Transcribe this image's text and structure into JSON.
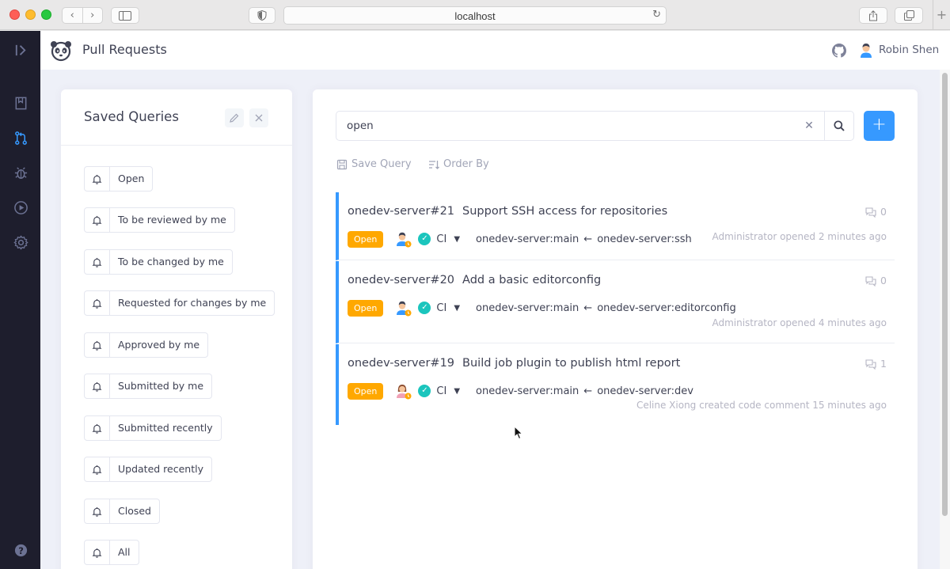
{
  "browser": {
    "url": "localhost"
  },
  "header": {
    "title": "Pull Requests",
    "user_name": "Robin Shen"
  },
  "saved_queries": {
    "title": "Saved Queries",
    "items": [
      {
        "label": "Open"
      },
      {
        "label": "To be reviewed by me"
      },
      {
        "label": "To be changed by me"
      },
      {
        "label": "Requested for changes by me"
      },
      {
        "label": "Approved by me"
      },
      {
        "label": "Submitted by me"
      },
      {
        "label": "Submitted recently"
      },
      {
        "label": "Updated recently"
      },
      {
        "label": "Closed"
      },
      {
        "label": "All"
      }
    ]
  },
  "search": {
    "value": "open"
  },
  "actions": {
    "save_query": "Save Query",
    "order_by": "Order By"
  },
  "pull_requests": [
    {
      "number": "onedev-server#21",
      "title": "Support SSH access for repositories",
      "comments": "0",
      "status": "Open",
      "ci": "CI",
      "target": "onedev-server:main",
      "source": "onedev-server:ssh",
      "activity": "Administrator opened 2 minutes ago"
    },
    {
      "number": "onedev-server#20",
      "title": "Add a basic editorconfig",
      "comments": "0",
      "status": "Open",
      "ci": "CI",
      "target": "onedev-server:main",
      "source": "onedev-server:editorconfig",
      "activity": "Administrator opened 4 minutes ago"
    },
    {
      "number": "onedev-server#19",
      "title": "Build job plugin to publish html report",
      "comments": "1",
      "status": "Open",
      "ci": "CI",
      "target": "onedev-server:main",
      "source": "onedev-server:dev",
      "activity": "Celine Xiong created code comment 15 minutes ago"
    }
  ],
  "colors": {
    "accent": "#3699ff",
    "sidebar": "#1e1e2d",
    "open_badge": "#ffa800",
    "ci_success": "#1bc5bd"
  }
}
